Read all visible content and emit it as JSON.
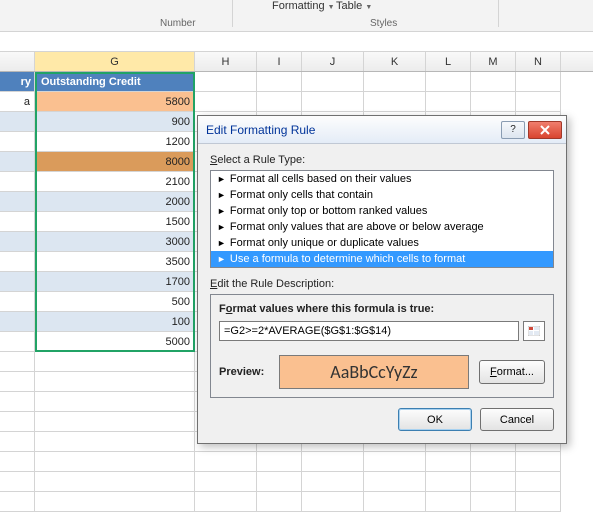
{
  "ribbon": {
    "formatting_label": "Formatting",
    "table_label": "Table",
    "number_group": "Number",
    "styles_group": "Styles"
  },
  "columns": {
    "F": "",
    "G": "G",
    "H": "H",
    "I": "I",
    "J": "J",
    "K": "K",
    "L": "L",
    "M": "M",
    "N": "N"
  },
  "table": {
    "header_left": "ry",
    "header_main": "Outstanding Credit",
    "left_val": "a",
    "values": [
      "5800",
      "900",
      "1200",
      "8000",
      "2100",
      "2000",
      "1500",
      "3000",
      "3500",
      "1700",
      "500",
      "100",
      "5000"
    ]
  },
  "dialog": {
    "title": "Edit Formatting Rule",
    "select_label": "Select a Rule Type:",
    "rules": [
      "Format all cells based on their values",
      "Format only cells that contain",
      "Format only top or bottom ranked values",
      "Format only values that are above or below average",
      "Format only unique or duplicate values",
      "Use a formula to determine which cells to format"
    ],
    "selected_rule_index": 5,
    "edit_desc_label": "Edit the Rule Description:",
    "formula_label": "Format values where this formula is true:",
    "formula_value": "=G2>=2*AVERAGE($G$1:$G$14)",
    "preview_label": "Preview:",
    "preview_sample": "AaBbCcYyZz",
    "format_btn": "Format...",
    "ok_btn": "OK",
    "cancel_btn": "Cancel",
    "help_btn": "?",
    "close_btn": "×"
  }
}
